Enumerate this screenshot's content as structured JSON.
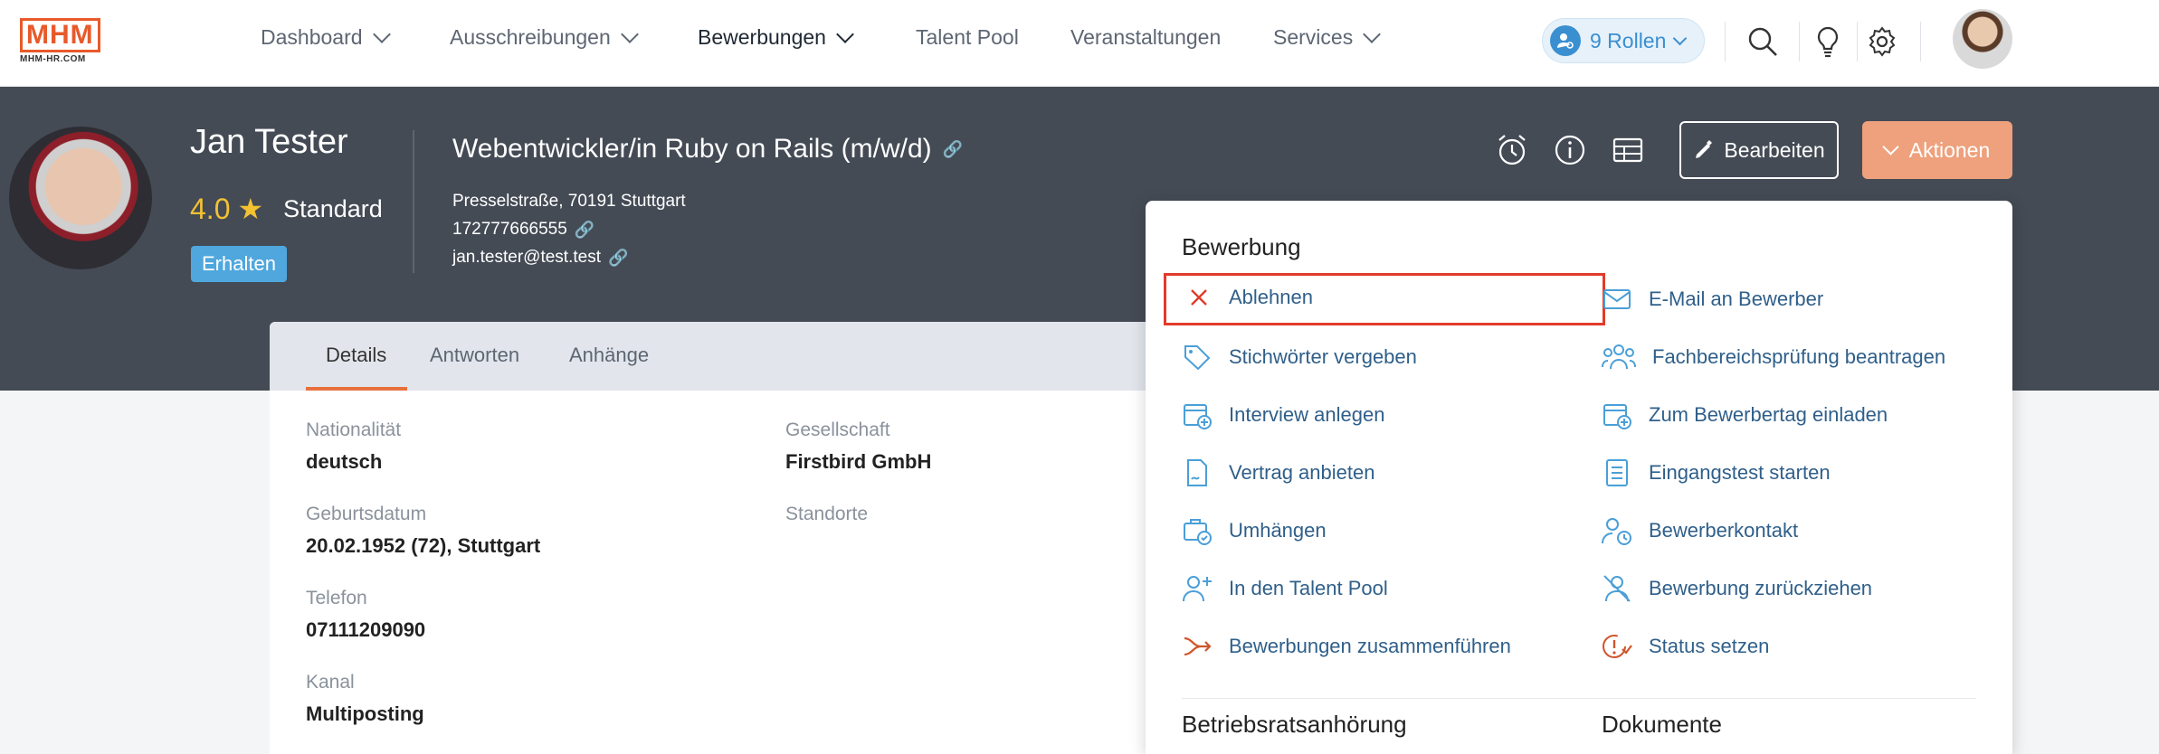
{
  "brand": {
    "logo_text": "MHM",
    "logo_sub": "MHM-HR.COM",
    "accent": "#e85a2a"
  },
  "nav": {
    "items": [
      {
        "label": "Dashboard",
        "has_chevron": true
      },
      {
        "label": "Ausschreibungen",
        "has_chevron": true
      },
      {
        "label": "Bewerbungen",
        "has_chevron": true,
        "active": true
      },
      {
        "label": "Talent Pool",
        "has_chevron": false
      },
      {
        "label": "Veranstaltungen",
        "has_chevron": false
      },
      {
        "label": "Services",
        "has_chevron": true
      }
    ],
    "roles_label": "9 Rollen"
  },
  "candidate": {
    "name": "Jan Tester",
    "rating": "4.0",
    "level": "Standard",
    "status": "Erhalten",
    "job_title": "Webentwickler/in Ruby on Rails (m/w/d)",
    "address": "Presselstraße, 70191 Stuttgart",
    "phone": "172777666555",
    "email": "jan.tester@test.test"
  },
  "header_buttons": {
    "edit": "Bearbeiten",
    "actions": "Aktionen"
  },
  "tabs": [
    "Details",
    "Antworten",
    "Anhänge"
  ],
  "details": {
    "nationality_label": "Nationalität",
    "nationality": "deutsch",
    "birth_label": "Geburtsdatum",
    "birth": "20.02.1952 (72), Stuttgart",
    "phone_label": "Telefon",
    "phone": "07111209090",
    "channel_label": "Kanal",
    "channel": "Multiposting",
    "company_label": "Gesellschaft",
    "company": "Firstbird GmbH",
    "locations_label": "Standorte"
  },
  "actions_menu": {
    "section1": "Bewerbung",
    "left_items": [
      {
        "label": "Ablehnen",
        "icon": "x-icon"
      },
      {
        "label": "Stichwörter vergeben",
        "icon": "tag-icon"
      },
      {
        "label": "Interview anlegen",
        "icon": "calendar-plus-icon"
      },
      {
        "label": "Vertrag anbieten",
        "icon": "contract-icon"
      },
      {
        "label": "Umhängen",
        "icon": "move-icon"
      },
      {
        "label": "In den Talent Pool",
        "icon": "user-plus-icon"
      },
      {
        "label": "Bewerbungen zusammenführen",
        "icon": "merge-icon"
      }
    ],
    "right_items": [
      {
        "label": "E-Mail an Bewerber",
        "icon": "mail-icon"
      },
      {
        "label": "Fachbereichsprüfung beantragen",
        "icon": "users-icon"
      },
      {
        "label": "Zum Bewerbertag einladen",
        "icon": "calendar-plus-icon"
      },
      {
        "label": "Eingangstest starten",
        "icon": "checklist-icon"
      },
      {
        "label": "Bewerberkontakt",
        "icon": "user-clock-icon"
      },
      {
        "label": "Bewerbung zurückziehen",
        "icon": "user-slash-icon"
      },
      {
        "label": "Status setzen",
        "icon": "status-icon"
      }
    ],
    "section2_left": "Betriebsratsanhörung",
    "section2_right": "Dokumente"
  },
  "colors": {
    "header_bg": "#444b55",
    "link_blue": "#2f5f8a",
    "action_orange": "#eea17c",
    "badge_blue": "#4fa7de",
    "star_yellow": "#f3c233",
    "highlight_red": "#e23b2a"
  }
}
